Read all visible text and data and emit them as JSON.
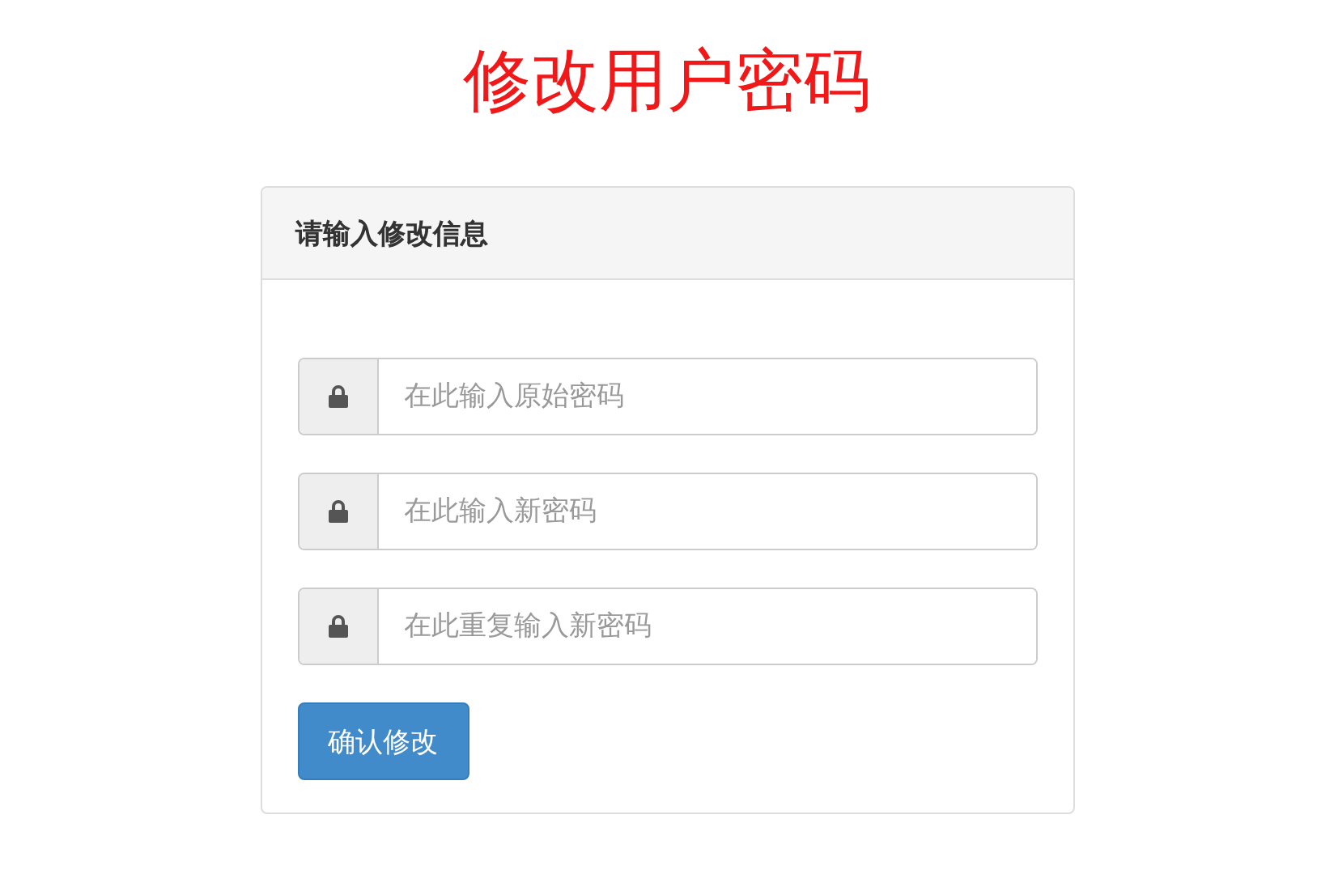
{
  "page_title": "修改用户密码",
  "panel": {
    "heading": "请输入修改信息",
    "fields": [
      {
        "placeholder": "在此输入原始密码"
      },
      {
        "placeholder": "在此输入新密码"
      },
      {
        "placeholder": "在此重复输入新密码"
      }
    ],
    "submit_button": "确认修改"
  }
}
